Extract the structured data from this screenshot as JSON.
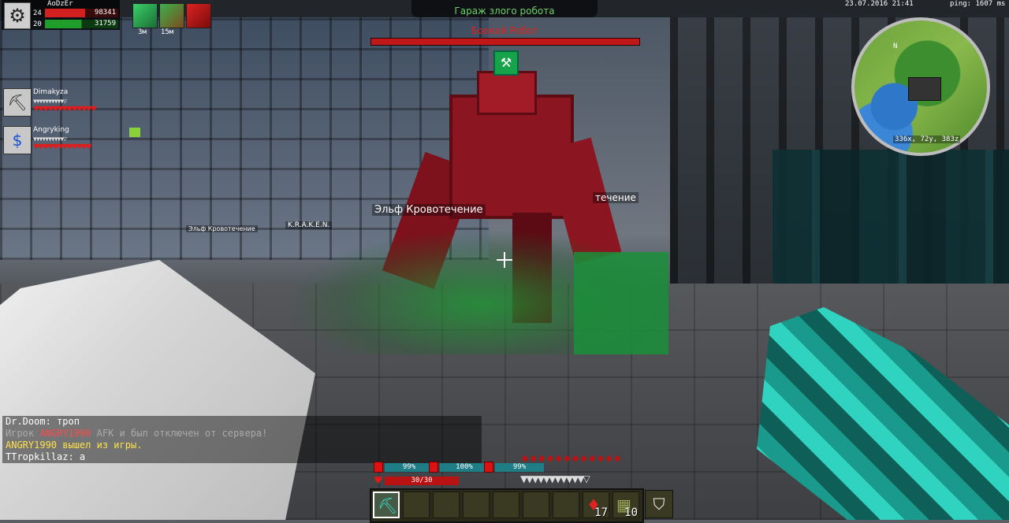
{
  "player": {
    "name": "AoDzEr",
    "level_top": "24",
    "level_bottom": "20",
    "health_value": "98341",
    "mana_value": "31759"
  },
  "buffs": {
    "timers": [
      "3м",
      "15м"
    ]
  },
  "party": [
    {
      "name": "Dimakyza",
      "icon": "pickaxe-icon",
      "glyph": "⛏",
      "armor": "▼▼▼▼▼▼▼▼▼▼▽",
      "hearts": "♥♥♥♥♥♥♥♥♥♥♥♥♥"
    },
    {
      "name": "Angryking",
      "icon": "money-bag-icon",
      "glyph": "$",
      "armor": "▼▼▼▼▼▼▼▼▼▼▽",
      "hearts": "♥♥♥♥♥♥♥♥♥♥♥♥"
    }
  ],
  "boss": {
    "location": "Гараж злого робота",
    "name": "Боевой Робот",
    "health_fraction": 1.0
  },
  "nametags": {
    "elf": "Эльф Кровотечение",
    "bleed_small": "Эльф Кровотечение",
    "kraken": "K.R.A.K.E.N.",
    "right_tag": "течение"
  },
  "datetime": "23.07.2016 21:41",
  "ping": "ping: 1607 ms",
  "minimap": {
    "north": "N",
    "coords": "336x, 72y, 383z"
  },
  "chat": [
    {
      "parts": [
        {
          "text": "Dr.Doom: троп",
          "color": "white"
        }
      ]
    },
    {
      "parts": [
        {
          "text": "Игрок ",
          "color": "grey"
        },
        {
          "text": "ANGRY1990",
          "color": "red"
        },
        {
          "text": " AFK и был отключен от сервера!",
          "color": "grey"
        }
      ]
    },
    {
      "parts": [
        {
          "text": "ANGRY1990 вышел из игры.",
          "color": "yellow"
        }
      ]
    },
    {
      "parts": [
        {
          "text": "TTropkillaz: a",
          "color": "white"
        }
      ]
    }
  ],
  "hud": {
    "stats": [
      "99%",
      "100%",
      "99%"
    ],
    "health": "30/30",
    "drops": "♦♦♦♦♦♦♦♦♦♦♦♦",
    "armor": "▼▼▼▼▼▼▼▼▼▼▼▽"
  },
  "hotbar": {
    "slots": [
      {
        "icon": "diamond-pickaxe-icon",
        "glyph": "⛏",
        "count": ""
      },
      {
        "icon": "",
        "glyph": "",
        "count": ""
      },
      {
        "icon": "",
        "glyph": "",
        "count": ""
      },
      {
        "icon": "",
        "glyph": "",
        "count": ""
      },
      {
        "icon": "",
        "glyph": "",
        "count": ""
      },
      {
        "icon": "",
        "glyph": "",
        "count": ""
      },
      {
        "icon": "",
        "glyph": "",
        "count": ""
      },
      {
        "icon": "potion-icon",
        "glyph": "♦",
        "count": "17"
      },
      {
        "icon": "book-icon",
        "glyph": "▦",
        "count": "10"
      }
    ],
    "selected": 0,
    "offhand_icon": "shield-icon",
    "offhand_glyph": "⛉"
  }
}
